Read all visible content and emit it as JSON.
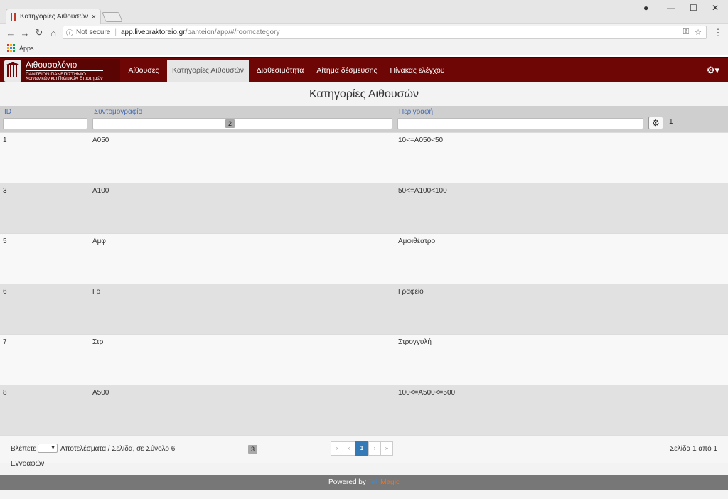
{
  "browser": {
    "tab_title": "Κατηγορίες Αιθουσών",
    "tab_close": "×",
    "not_secure": "Not secure",
    "url_host": "app.livepraktoreio.gr",
    "url_path": "/panteion/app/#/roomcategory",
    "bookmark_apps": "Apps"
  },
  "navbar": {
    "brand_title": "Αιθουσολόγιο",
    "brand_sub1": "ΠΑΝΤΕΙΟΝ ΠΑΝΕΠΙΣΤΗΜΙΟ",
    "brand_sub2": "Κοινωνικών και Πολιτικών Επιστημών",
    "items": [
      {
        "label": "Αίθουσες"
      },
      {
        "label": "Κατηγορίες Αιθουσών"
      },
      {
        "label": "Διαθεσιμότητα"
      },
      {
        "label": "Αίτημα δέσμευσης"
      },
      {
        "label": "Πίνακας ελέγχου"
      }
    ],
    "settings_icon": "gear-icon"
  },
  "page": {
    "title": "Κατηγορίες Αιθουσών"
  },
  "table": {
    "headers": {
      "id": "ID",
      "abbr": "Συντομογραφία",
      "desc": "Περιγραφή"
    },
    "badge_filter": "2",
    "count_badge": "1",
    "rows": [
      {
        "id": "1",
        "abbr": "Α050",
        "desc": "10<=Α050<50"
      },
      {
        "id": "3",
        "abbr": "Α100",
        "desc": "50<=Α100<100"
      },
      {
        "id": "5",
        "abbr": "Αμφ",
        "desc": "Αμφιθέατρο"
      },
      {
        "id": "6",
        "abbr": "Γρ",
        "desc": "Γραφείο"
      },
      {
        "id": "7",
        "abbr": "Στρ",
        "desc": "Στρογγυλή"
      },
      {
        "id": "8",
        "abbr": "Α500",
        "desc": "100<=Α500<=500"
      }
    ]
  },
  "footer": {
    "show_label": "Βλέπετε",
    "results_label": "Αποτελέσματα / Σελίδα, σε Σύνολο 6",
    "results_label2": "Εγγραφών",
    "page_badge": "3",
    "pager": {
      "first": "«",
      "prev": "‹",
      "current": "1",
      "next": "›",
      "last": "»"
    },
    "page_info": "Σελίδα 1 από 1"
  },
  "powered": {
    "prefix": "Powered by",
    "brand1": "Tell",
    "brand2": "Magic"
  },
  "colors": {
    "navbar": "#6e0606",
    "link": "#4a6fb0",
    "pager_active": "#337ab7"
  }
}
